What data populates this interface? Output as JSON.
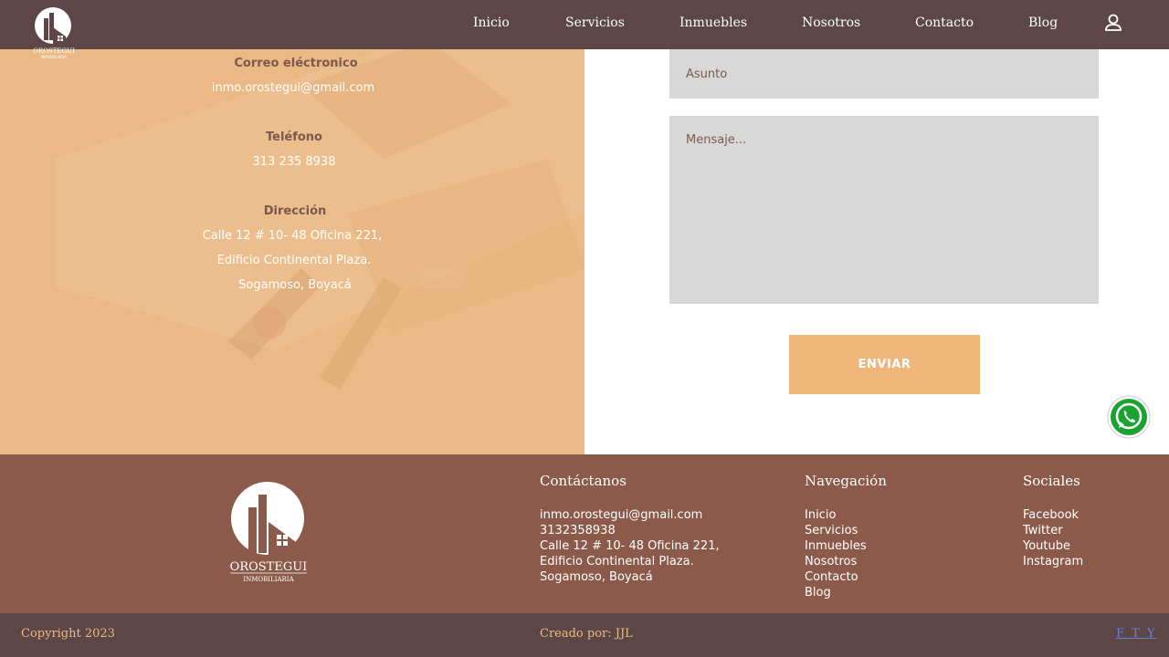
{
  "brand": {
    "name": "OROSTEGUI",
    "subtitle": "INMOBILIARIA"
  },
  "nav": {
    "items": [
      {
        "label": "Inicio"
      },
      {
        "label": "Servicios"
      },
      {
        "label": "Inmuebles"
      },
      {
        "label": "Nosotros"
      },
      {
        "label": "Contacto"
      },
      {
        "label": "Blog"
      }
    ],
    "user_icon": "user-icon"
  },
  "contact_panel": {
    "email_label": "Correo eléctronico",
    "email_value": "inmo.orostegui@gmail.com",
    "phone_label": "Teléfono",
    "phone_value": "313 235 8938",
    "address_label": "Dirección",
    "address_lines": [
      "Calle 12 # 10- 48 Oficina 221,",
      "Edificio Continental Plaza.",
      "Sogamoso, Boyacá"
    ]
  },
  "form": {
    "subject_placeholder": "Asunto",
    "message_placeholder": "Mensaje...",
    "send_label": "ENVIAR"
  },
  "footer": {
    "contact": {
      "heading": "Contáctanos",
      "lines": [
        "inmo.orostegui@gmail.com",
        "3132358938",
        "Calle 12 # 10- 48 Oficina 221,",
        "Edificio Continental Plaza.",
        "Sogamoso, Boyacá"
      ]
    },
    "navigation": {
      "heading": "Navegación",
      "links": [
        "Inicio",
        "Servicios",
        "Inmuebles",
        "Nosotros",
        "Contacto",
        "Blog"
      ]
    },
    "social": {
      "heading": "Sociales",
      "links": [
        "Facebook",
        "Twitter",
        "Youtube",
        "Instagram"
      ]
    }
  },
  "bottom": {
    "copyright": "Copyright 2023",
    "credits": "Creado por: JJL",
    "social_letters": "F T Y"
  },
  "colors": {
    "header": "#5c4646",
    "panel": "#eab985",
    "footer": "#8b5a4a",
    "button": "#f0b77b",
    "field": "#d8d8d8",
    "label": "#7a5a4d"
  }
}
